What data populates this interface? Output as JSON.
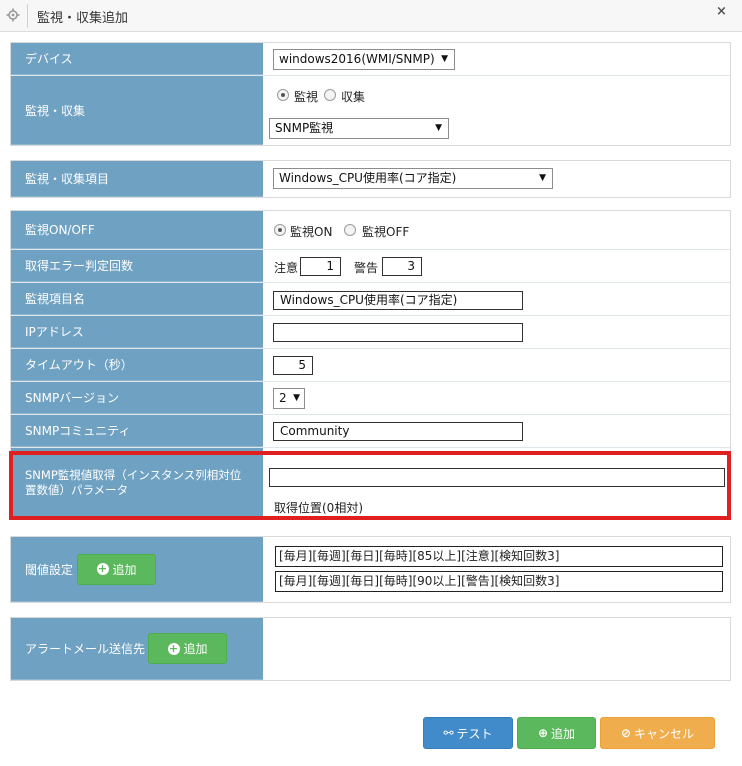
{
  "window": {
    "title": "監視・収集追加",
    "close_glyph": "×",
    "icons": {
      "settings": "gear-icon",
      "close": "close-icon"
    }
  },
  "form": {
    "device": {
      "label": "デバイス",
      "value": "windows2016(WMI/SNMP)"
    },
    "monitor_collect": {
      "label": "監視・収集",
      "options": [
        {
          "label": "監視",
          "checked": true
        },
        {
          "label": "収集",
          "checked": false
        }
      ],
      "type_value": "SNMP監視"
    },
    "item": {
      "label": "監視・収集項目",
      "value": "Windows_CPU使用率(コア指定)"
    },
    "monitor_onoff": {
      "label": "監視ON/OFF",
      "options": [
        {
          "label": "監視ON",
          "checked": true
        },
        {
          "label": "監視OFF",
          "checked": false
        }
      ]
    },
    "error_count": {
      "label": "取得エラー判定回数",
      "caution_label": "注意",
      "caution_value": "1",
      "warning_label": "警告",
      "warning_value": "3"
    },
    "item_name": {
      "label": "監視項目名",
      "value": "Windows_CPU使用率(コア指定)"
    },
    "ip_address": {
      "label": "IPアドレス",
      "value": ""
    },
    "timeout": {
      "label": "タイムアウト（秒）",
      "value": "5"
    },
    "snmp_version": {
      "label": "SNMPバージョン",
      "value": "2"
    },
    "snmp_community": {
      "label": "SNMPコミュニティ",
      "value": "Community"
    },
    "snmp_param": {
      "label_line1": "SNMP監視値取得（インスタンス列相対位",
      "label_line2": "置数値）パラメータ",
      "value": "",
      "hint": "取得位置(0相対)"
    },
    "threshold": {
      "label": "閾値設定",
      "add_label": "追加",
      "entries": [
        "[毎月][毎週][毎日][毎時][85以上][注意][検知回数3]",
        "[毎月][毎週][毎日][毎時][90以上][警告][検知回数3]"
      ]
    },
    "alert_mail": {
      "label": "アラートメール送信先",
      "add_label": "追加"
    }
  },
  "footer": {
    "test_label": "テスト",
    "add_label": "追加",
    "cancel_label": "キャンセル",
    "colors": {
      "test": "#428bca",
      "add": "#5cb85c",
      "cancel": "#f0ad4e"
    }
  },
  "colors": {
    "label_bg": "#6fa1c2",
    "highlight": "#e02020"
  }
}
